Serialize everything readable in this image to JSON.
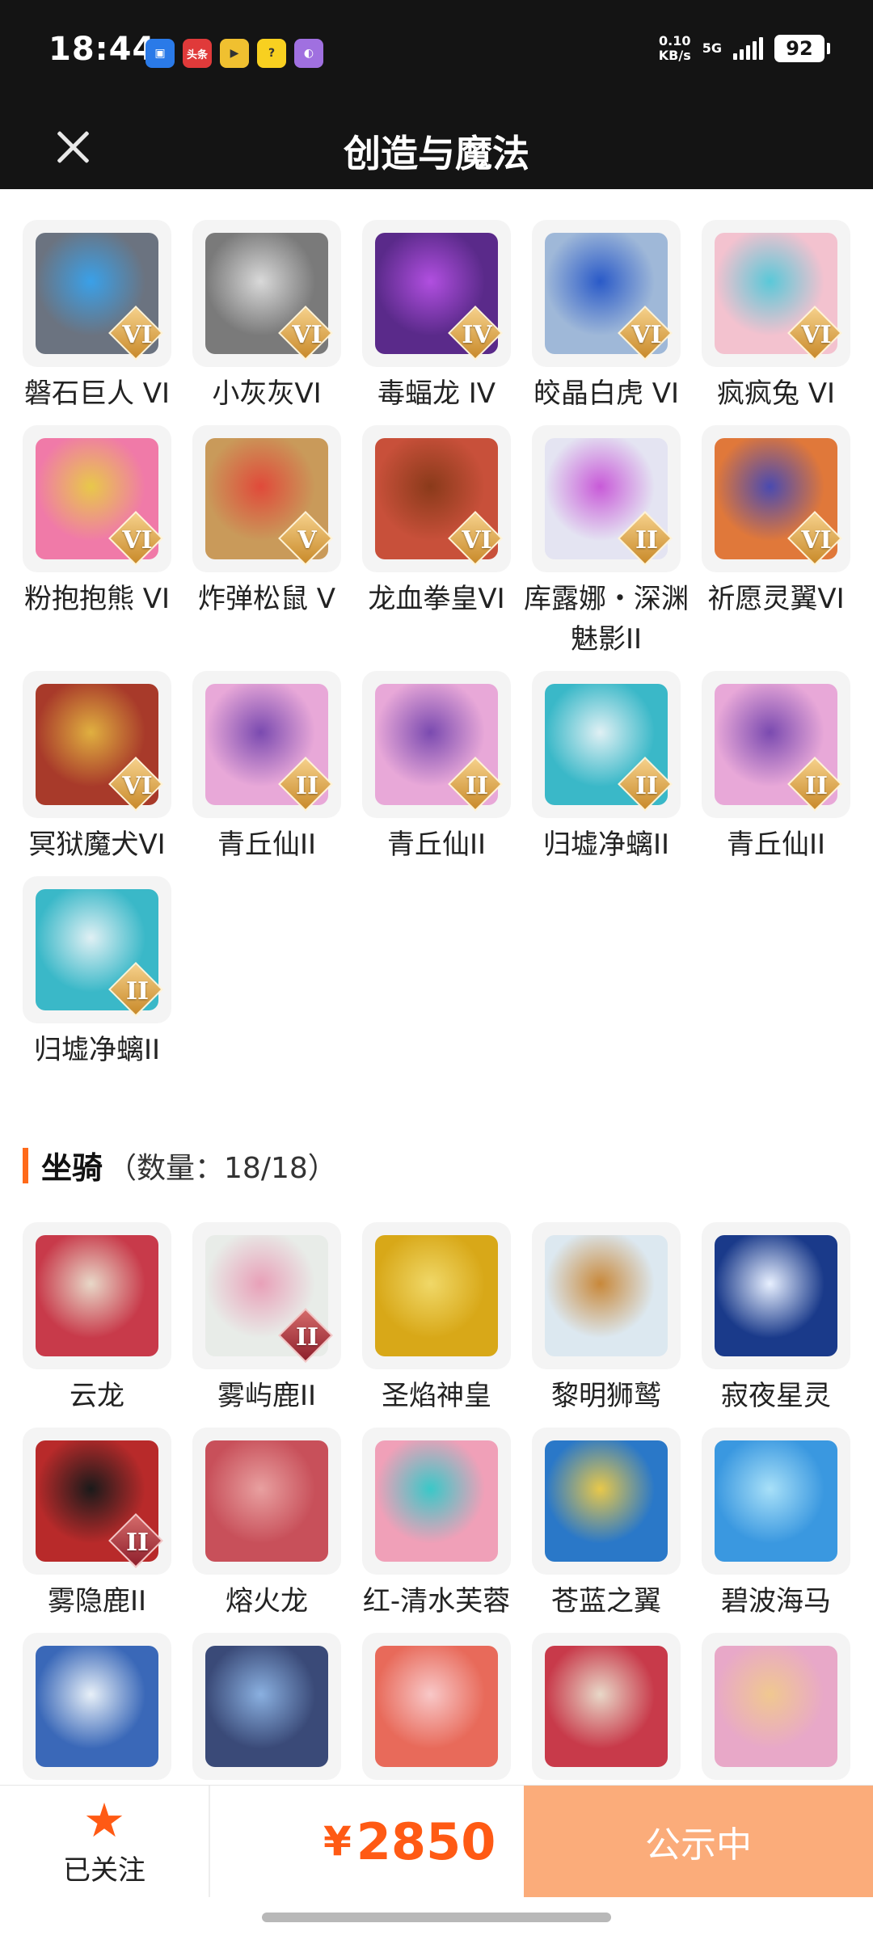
{
  "status": {
    "time": "18:44",
    "apps": [
      "app-a",
      "头条",
      "app-c",
      "app-d",
      "app-e"
    ],
    "net_speed": "0.10",
    "net_unit": "KB/s",
    "net_type": "5G",
    "battery": "92"
  },
  "nav": {
    "title": "创造与魔法"
  },
  "pets": [
    {
      "name": "磐石巨人 VI",
      "grade": "VI",
      "color": "#6b7380",
      "accent": "#3aa0e8"
    },
    {
      "name": "小灰灰VI",
      "grade": "VI",
      "color": "#7a7a7a",
      "accent": "#d9d9d9"
    },
    {
      "name": "毒蝠龙 IV",
      "grade": "IV",
      "color": "#5a2a8a",
      "accent": "#b14fe0"
    },
    {
      "name": "皎晶白虎 VI",
      "grade": "VI",
      "color": "#9fb8d8",
      "accent": "#2a5ac8"
    },
    {
      "name": "疯疯兔 VI",
      "grade": "VI",
      "color": "#f3c2cf",
      "accent": "#5ac8d8"
    },
    {
      "name": "粉抱抱熊 VI",
      "grade": "VI",
      "color": "#f07aa8",
      "accent": "#e8c84a"
    },
    {
      "name": "炸弹松鼠 V",
      "grade": "V",
      "color": "#c99a5a",
      "accent": "#e04a3a"
    },
    {
      "name": "龙血拳皇VI",
      "grade": "VI",
      "color": "#c8503a",
      "accent": "#8a3a1a"
    },
    {
      "name": "库露娜・深渊魅影II",
      "grade": "II",
      "color": "#e4e4f2",
      "accent": "#c85ad8"
    },
    {
      "name": "祈愿灵翼VI",
      "grade": "VI",
      "color": "#e0783a",
      "accent": "#4a4ab0"
    },
    {
      "name": "冥狱魔犬VI",
      "grade": "VI",
      "color": "#a83a2a",
      "accent": "#e0b040"
    },
    {
      "name": "青丘仙II",
      "grade": "II",
      "color": "#e8a8d8",
      "accent": "#7a4ab0"
    },
    {
      "name": "青丘仙II",
      "grade": "II",
      "color": "#e8a8d8",
      "accent": "#7a4ab0"
    },
    {
      "name": "归墟净螭II",
      "grade": "II",
      "color": "#3ab8c8",
      "accent": "#e0f0f4"
    },
    {
      "name": "青丘仙II",
      "grade": "II",
      "color": "#e8a8d8",
      "accent": "#7a4ab0"
    },
    {
      "name": "归墟净螭II",
      "grade": "II",
      "color": "#3ab8c8",
      "accent": "#e0f0f4"
    }
  ],
  "mounts_section": {
    "title": "坐骑",
    "count": "（数量：18/18）"
  },
  "mounts": [
    {
      "name": "云龙",
      "grade": "",
      "color": "#c83a4a",
      "accent": "#e8d8c8"
    },
    {
      "name": "雾屿鹿II",
      "grade": "II",
      "color": "#e8ece8",
      "accent": "#e8a0b8"
    },
    {
      "name": "圣焰神皇",
      "grade": "",
      "color": "#d8a818",
      "accent": "#f0d868"
    },
    {
      "name": "黎明狮鹫",
      "grade": "",
      "color": "#dce8f0",
      "accent": "#c8883a"
    },
    {
      "name": "寂夜星灵",
      "grade": "",
      "color": "#1a3a8a",
      "accent": "#e8f0ff"
    },
    {
      "name": "雾隐鹿II",
      "grade": "II",
      "color": "#b82a2a",
      "accent": "#1a1a1a"
    },
    {
      "name": "熔火龙",
      "grade": "",
      "color": "#c8505a",
      "accent": "#e8a0a0"
    },
    {
      "name": "红-清水芙蓉",
      "grade": "",
      "color": "#f0a0b8",
      "accent": "#3ac8c8"
    },
    {
      "name": "苍蓝之翼",
      "grade": "",
      "color": "#2a78c8",
      "accent": "#e8c84a"
    },
    {
      "name": "碧波海马",
      "grade": "",
      "color": "#3a98e0",
      "accent": "#a8e0f8"
    },
    {
      "name": "",
      "grade": "",
      "color": "#3a68b8",
      "accent": "#e8f0f8"
    },
    {
      "name": "",
      "grade": "",
      "color": "#3a4a78",
      "accent": "#8ab0e0"
    },
    {
      "name": "",
      "grade": "",
      "color": "#e86a5a",
      "accent": "#f8c8c8"
    },
    {
      "name": "",
      "grade": "",
      "color": "#c83a4a",
      "accent": "#e8d8c8"
    },
    {
      "name": "",
      "grade": "",
      "color": "#e8a8c8",
      "accent": "#f0c890"
    }
  ],
  "bottom": {
    "follow_label": "已关注",
    "price_symbol": "¥",
    "price": "2850",
    "cta": "公示中"
  },
  "colors": {
    "accent": "#ff5a14",
    "cta_bg": "#fbac7a",
    "header_bg": "#141414"
  }
}
